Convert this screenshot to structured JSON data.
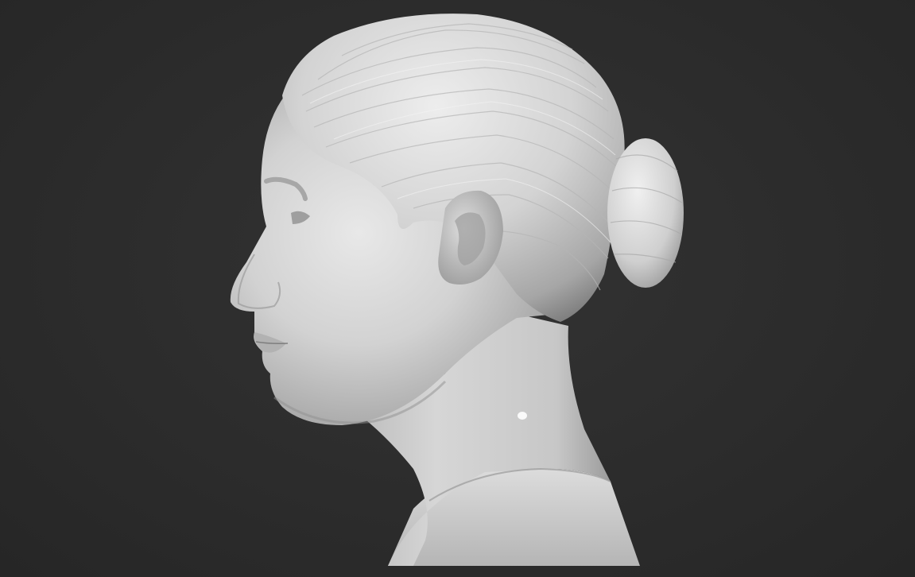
{
  "scene": {
    "subject": "sculpt-bust-profile",
    "view": "left-profile",
    "colors": {
      "background": "#2b2b2b",
      "clay_light": "#e4e4e4",
      "clay_mid": "#c2c2c2",
      "clay_shadow": "#8e8e8e",
      "highlight": "#ffffff"
    }
  }
}
